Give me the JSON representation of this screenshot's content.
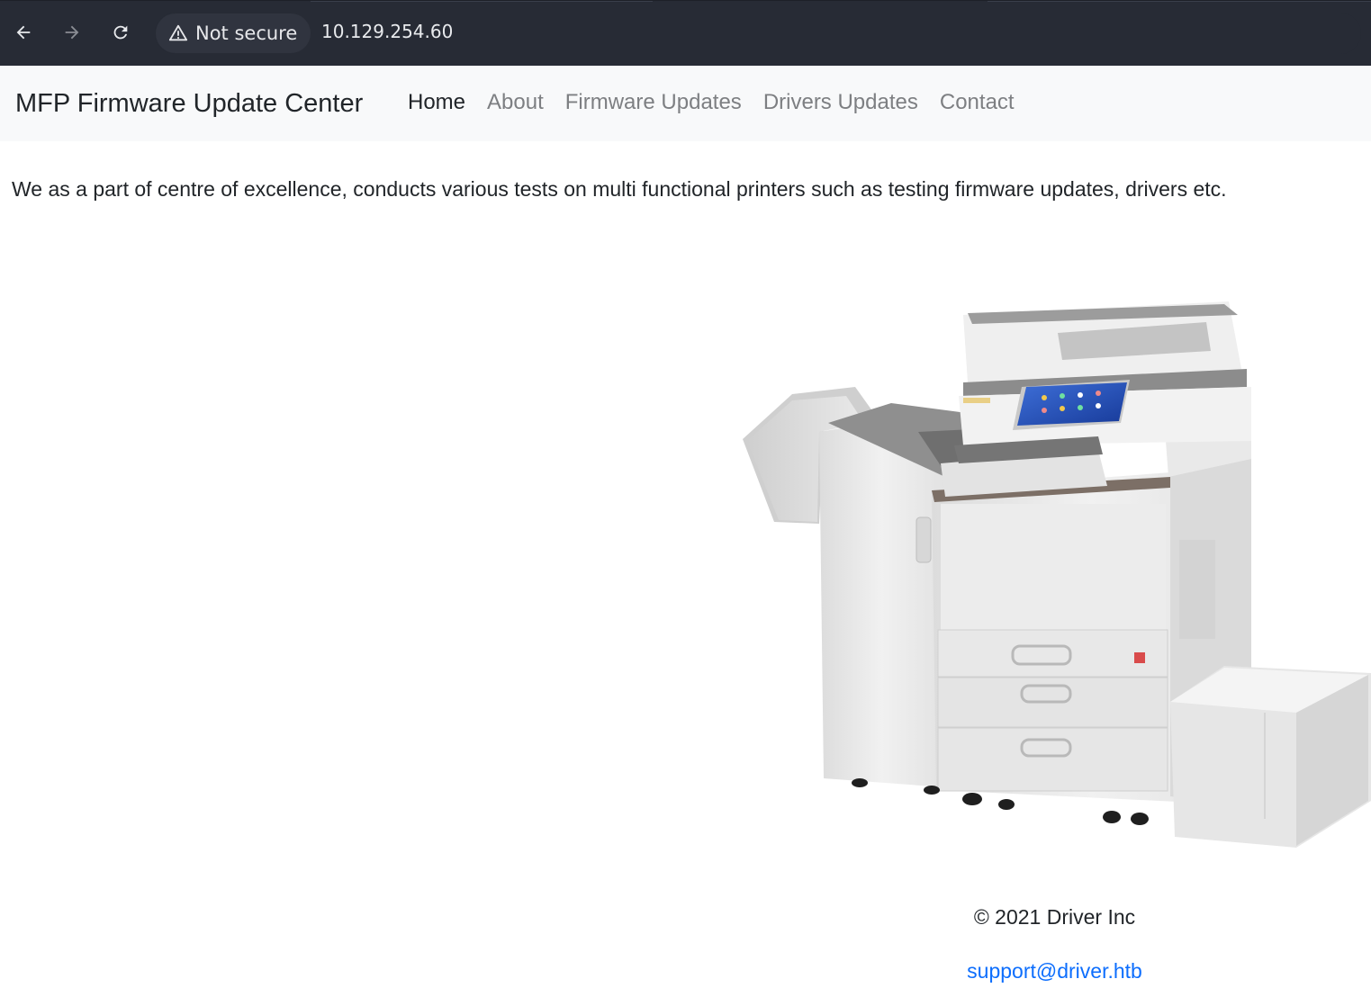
{
  "browser": {
    "security_label": "Not secure",
    "url": "10.129.254.60",
    "icons": [
      "back-arrow-icon",
      "forward-arrow-icon",
      "reload-icon",
      "warning-icon"
    ]
  },
  "navbar": {
    "brand": "MFP Firmware Update Center",
    "links": [
      {
        "label": "Home",
        "active": true
      },
      {
        "label": "About",
        "active": false
      },
      {
        "label": "Firmware Updates",
        "active": false
      },
      {
        "label": "Drivers Updates",
        "active": false
      },
      {
        "label": "Contact",
        "active": false
      }
    ]
  },
  "main": {
    "intro": "We as a part of centre of excellence, conducts various tests on multi functional printers such as testing firmware updates, drivers etc.",
    "image_subject": "multifunction-printer"
  },
  "footer": {
    "copyright": "© 2021 Driver Inc",
    "email": "support@driver.htb"
  },
  "colors": {
    "chrome_bg": "#272b35",
    "navbar_bg": "#f8f9fa",
    "link_muted": "#7d7f82",
    "link_active": "#212529",
    "email_link": "#0d6efd"
  }
}
